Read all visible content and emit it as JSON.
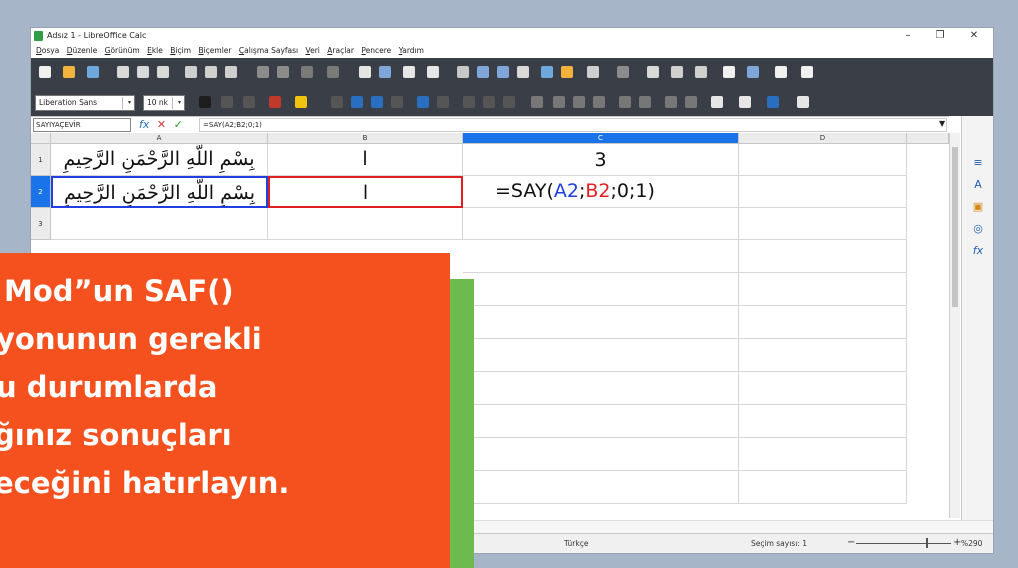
{
  "window": {
    "title": "Adsız 1 - LibreOffice Calc",
    "min_glyph": "–",
    "max_glyph": "❐",
    "close_glyph": "✕"
  },
  "menu": [
    "Dosya",
    "Düzenle",
    "Görünüm",
    "Ekle",
    "Biçim",
    "Biçemler",
    "Çalışma Sayfası",
    "Veri",
    "Araçlar",
    "Pencere",
    "Yardım"
  ],
  "toolbar": {
    "font_name": "Liberation Sans",
    "font_size": "10 nk",
    "dropdown_glyph": "▾"
  },
  "formula_bar": {
    "name_box": "SAYIYAÇEVİR",
    "fx": "fx",
    "cancel": "✕",
    "accept": "✓",
    "content": "=SAY(A2;B2;0;1)",
    "dd_glyph": "▼"
  },
  "columns": [
    "A",
    "B",
    "C",
    "D"
  ],
  "rows": [
    "1",
    "2",
    "3"
  ],
  "cells": {
    "A1": "بِسْمِ اللَّهِ الرَّحْمَنِ الرَّحِيمِ",
    "B1": "ا",
    "C1": "3",
    "A2": "بِسْمِ اللَّهِ الرَّحْمَنِ الرَّحِيمِ",
    "B2": "ا",
    "C2": {
      "p1": "=SAY(",
      "ref1": "A2",
      "sep": ";",
      "ref2": "B2",
      "p2": ";0;1)"
    }
  },
  "ref_colors": {
    "A2": "#1f3fe0",
    "B2": "#e02020"
  },
  "sidebar_icons": [
    "≡",
    "A",
    "▣",
    "◎",
    "fx"
  ],
  "status": {
    "language": "Türkçe",
    "selection": "Seçim sayısı: 1",
    "zoom": "%290",
    "zoom_minus": "−",
    "zoom_plus": "+"
  },
  "caption": {
    "lines": [
      "Mod”un SAF()",
      "yonunun gerekli",
      "u durumlarda",
      "ğınız sonuçları",
      "eceğini hatırlayın."
    ]
  }
}
